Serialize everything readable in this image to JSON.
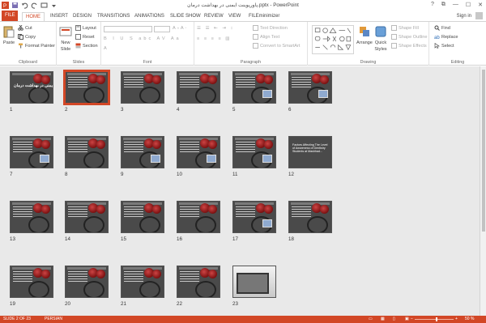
{
  "window": {
    "title": "پاورپوینت ایمنی در بهداشت درمان.pptx - PowerPoint",
    "help": "?",
    "controls": [
      "⧉",
      "—",
      "☐",
      "✕"
    ],
    "signin": "Sign in"
  },
  "tabs": [
    "FILE",
    "HOME",
    "INSERT",
    "DESIGN",
    "TRANSITIONS",
    "ANIMATIONS",
    "SLIDE SHOW",
    "REVIEW",
    "VIEW",
    "FILEminimizer"
  ],
  "active_tab": "HOME",
  "ribbon": {
    "clipboard": {
      "paste": "Paste",
      "cut": "Cut",
      "copy": "Copy",
      "format_painter": "Format Painter",
      "label": "Clipboard"
    },
    "slides": {
      "new_slide": "New",
      "new_slide2": "Slide",
      "layout": "Layout",
      "reset": "Reset",
      "section": "Section",
      "label": "Slides"
    },
    "font": {
      "label": "Font"
    },
    "paragraph": {
      "text_direction": "Text Direction",
      "align_text": "Align Text",
      "convert": "Convert to SmartArt",
      "label": "Paragraph"
    },
    "drawing": {
      "arrange": "Arrange",
      "quick_styles": "Quick",
      "quick_styles2": "Styles",
      "shape_fill": "Shape Fill",
      "shape_outline": "Shape Outline",
      "shape_effects": "Shape Effects",
      "label": "Drawing"
    },
    "editing": {
      "find": "Find",
      "replace": "Replace",
      "select": "Select",
      "label": "Editing"
    }
  },
  "slides": [
    {
      "num": "1",
      "title": "ایمنی در بهداشت درمان"
    },
    {
      "num": "2",
      "selected": true
    },
    {
      "num": "3"
    },
    {
      "num": "4"
    },
    {
      "num": "5"
    },
    {
      "num": "6"
    },
    {
      "num": "7"
    },
    {
      "num": "8"
    },
    {
      "num": "9"
    },
    {
      "num": "10"
    },
    {
      "num": "11"
    },
    {
      "num": "12",
      "title": "Factors Affecting The Level of Awareness of Dentistry Students at Mashhad..."
    },
    {
      "num": "13"
    },
    {
      "num": "14"
    },
    {
      "num": "15"
    },
    {
      "num": "16"
    },
    {
      "num": "17"
    },
    {
      "num": "18"
    },
    {
      "num": "19"
    },
    {
      "num": "20"
    },
    {
      "num": "21"
    },
    {
      "num": "22"
    },
    {
      "num": "23"
    }
  ],
  "status": {
    "slide": "SLIDE 2 OF 23",
    "lang": "PERSIAN",
    "zoom": "50 %"
  },
  "colors": {
    "accent": "#d24726"
  }
}
